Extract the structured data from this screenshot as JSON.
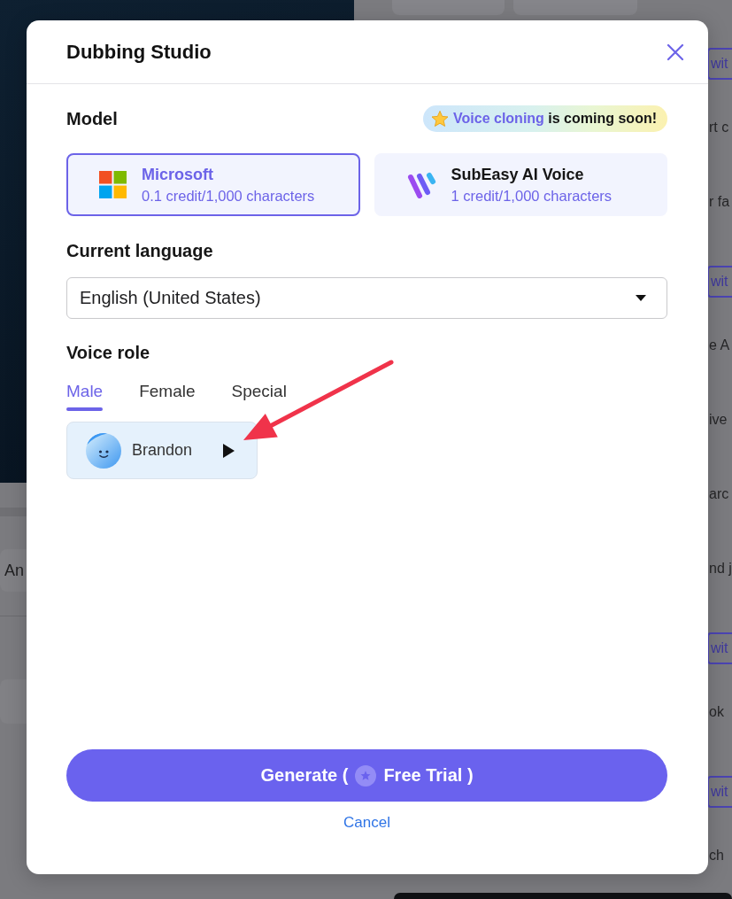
{
  "dialog": {
    "title": "Dubbing Studio"
  },
  "model": {
    "label": "Model",
    "notice": {
      "highlight": "Voice cloning",
      "text": "is coming soon!"
    },
    "options": [
      {
        "kind": "microsoft",
        "name": "Microsoft",
        "price": "0.1 credit/1,000 characters",
        "selected": true
      },
      {
        "kind": "subeasy",
        "name": "SubEasy AI Voice",
        "price": "1 credit/1,000 characters",
        "selected": false
      }
    ]
  },
  "language": {
    "label": "Current language",
    "value": "English (United States)"
  },
  "voice_role": {
    "label": "Voice role",
    "tabs": [
      {
        "label": "Male",
        "selected": true
      },
      {
        "label": "Female",
        "selected": false
      },
      {
        "label": "Special",
        "selected": false
      }
    ],
    "voices": [
      {
        "name": "Brandon"
      }
    ]
  },
  "footer": {
    "generate": {
      "label": "Generate (",
      "trial": "Free Trial )"
    },
    "cancel": "Cancel"
  },
  "background": {
    "left_rows": [
      "An"
    ],
    "right_items": [
      {
        "kind": "button",
        "label": "wit"
      },
      {
        "kind": "text",
        "label": "rt c"
      },
      {
        "kind": "text",
        "label": "r fa"
      },
      {
        "kind": "button",
        "label": "wit"
      },
      {
        "kind": "text",
        "label": "e A"
      },
      {
        "kind": "text",
        "label": "ive"
      },
      {
        "kind": "text",
        "label": "arc"
      },
      {
        "kind": "text",
        "label": "nd j"
      },
      {
        "kind": "button",
        "label": "wit"
      },
      {
        "kind": "text",
        "label": "ok"
      },
      {
        "kind": "button",
        "label": "wit"
      },
      {
        "kind": "text",
        "label": "ch"
      }
    ]
  }
}
